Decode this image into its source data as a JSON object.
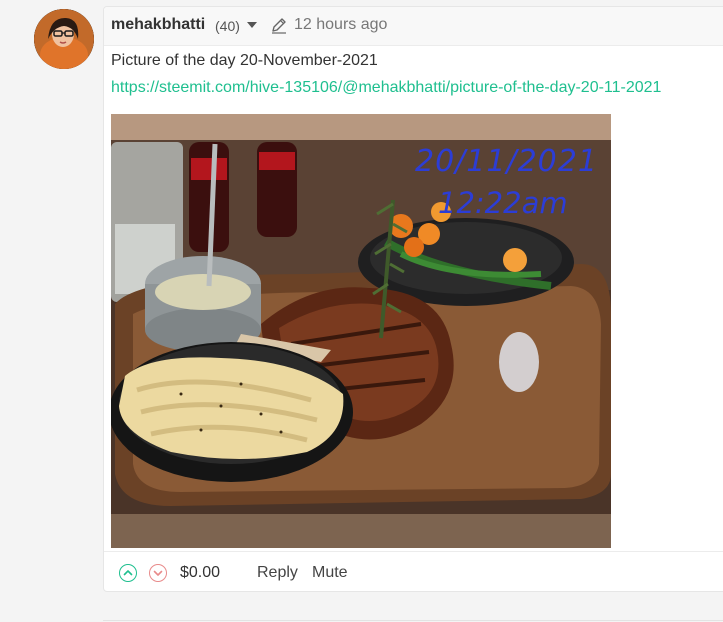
{
  "comment": {
    "author": "mehakbhatti",
    "reputation": "(40)",
    "timestamp": "12 hours ago",
    "body_title": "Picture of the day 20-November-2021",
    "body_link": "https://steemit.com/hive-135106/@mehakbhatti/picture-of-the-day-20-11-2021",
    "image": {
      "overlay_date": "20/11/2021",
      "overlay_time": "12:22am"
    }
  },
  "footer": {
    "payout": "$0.00",
    "reply_label": "Reply",
    "mute_label": "Mute"
  },
  "icons": {
    "avatar": "avatar",
    "dropdown": "chevron-down-icon",
    "edit": "pencil-icon",
    "upvote": "upvote-icon",
    "downvote": "downvote-icon"
  },
  "colors": {
    "link": "#1fbf8f",
    "upvote": "#1fbf8f",
    "downvote": "#e88b8b",
    "overlay_text": "#2c3dd6"
  }
}
